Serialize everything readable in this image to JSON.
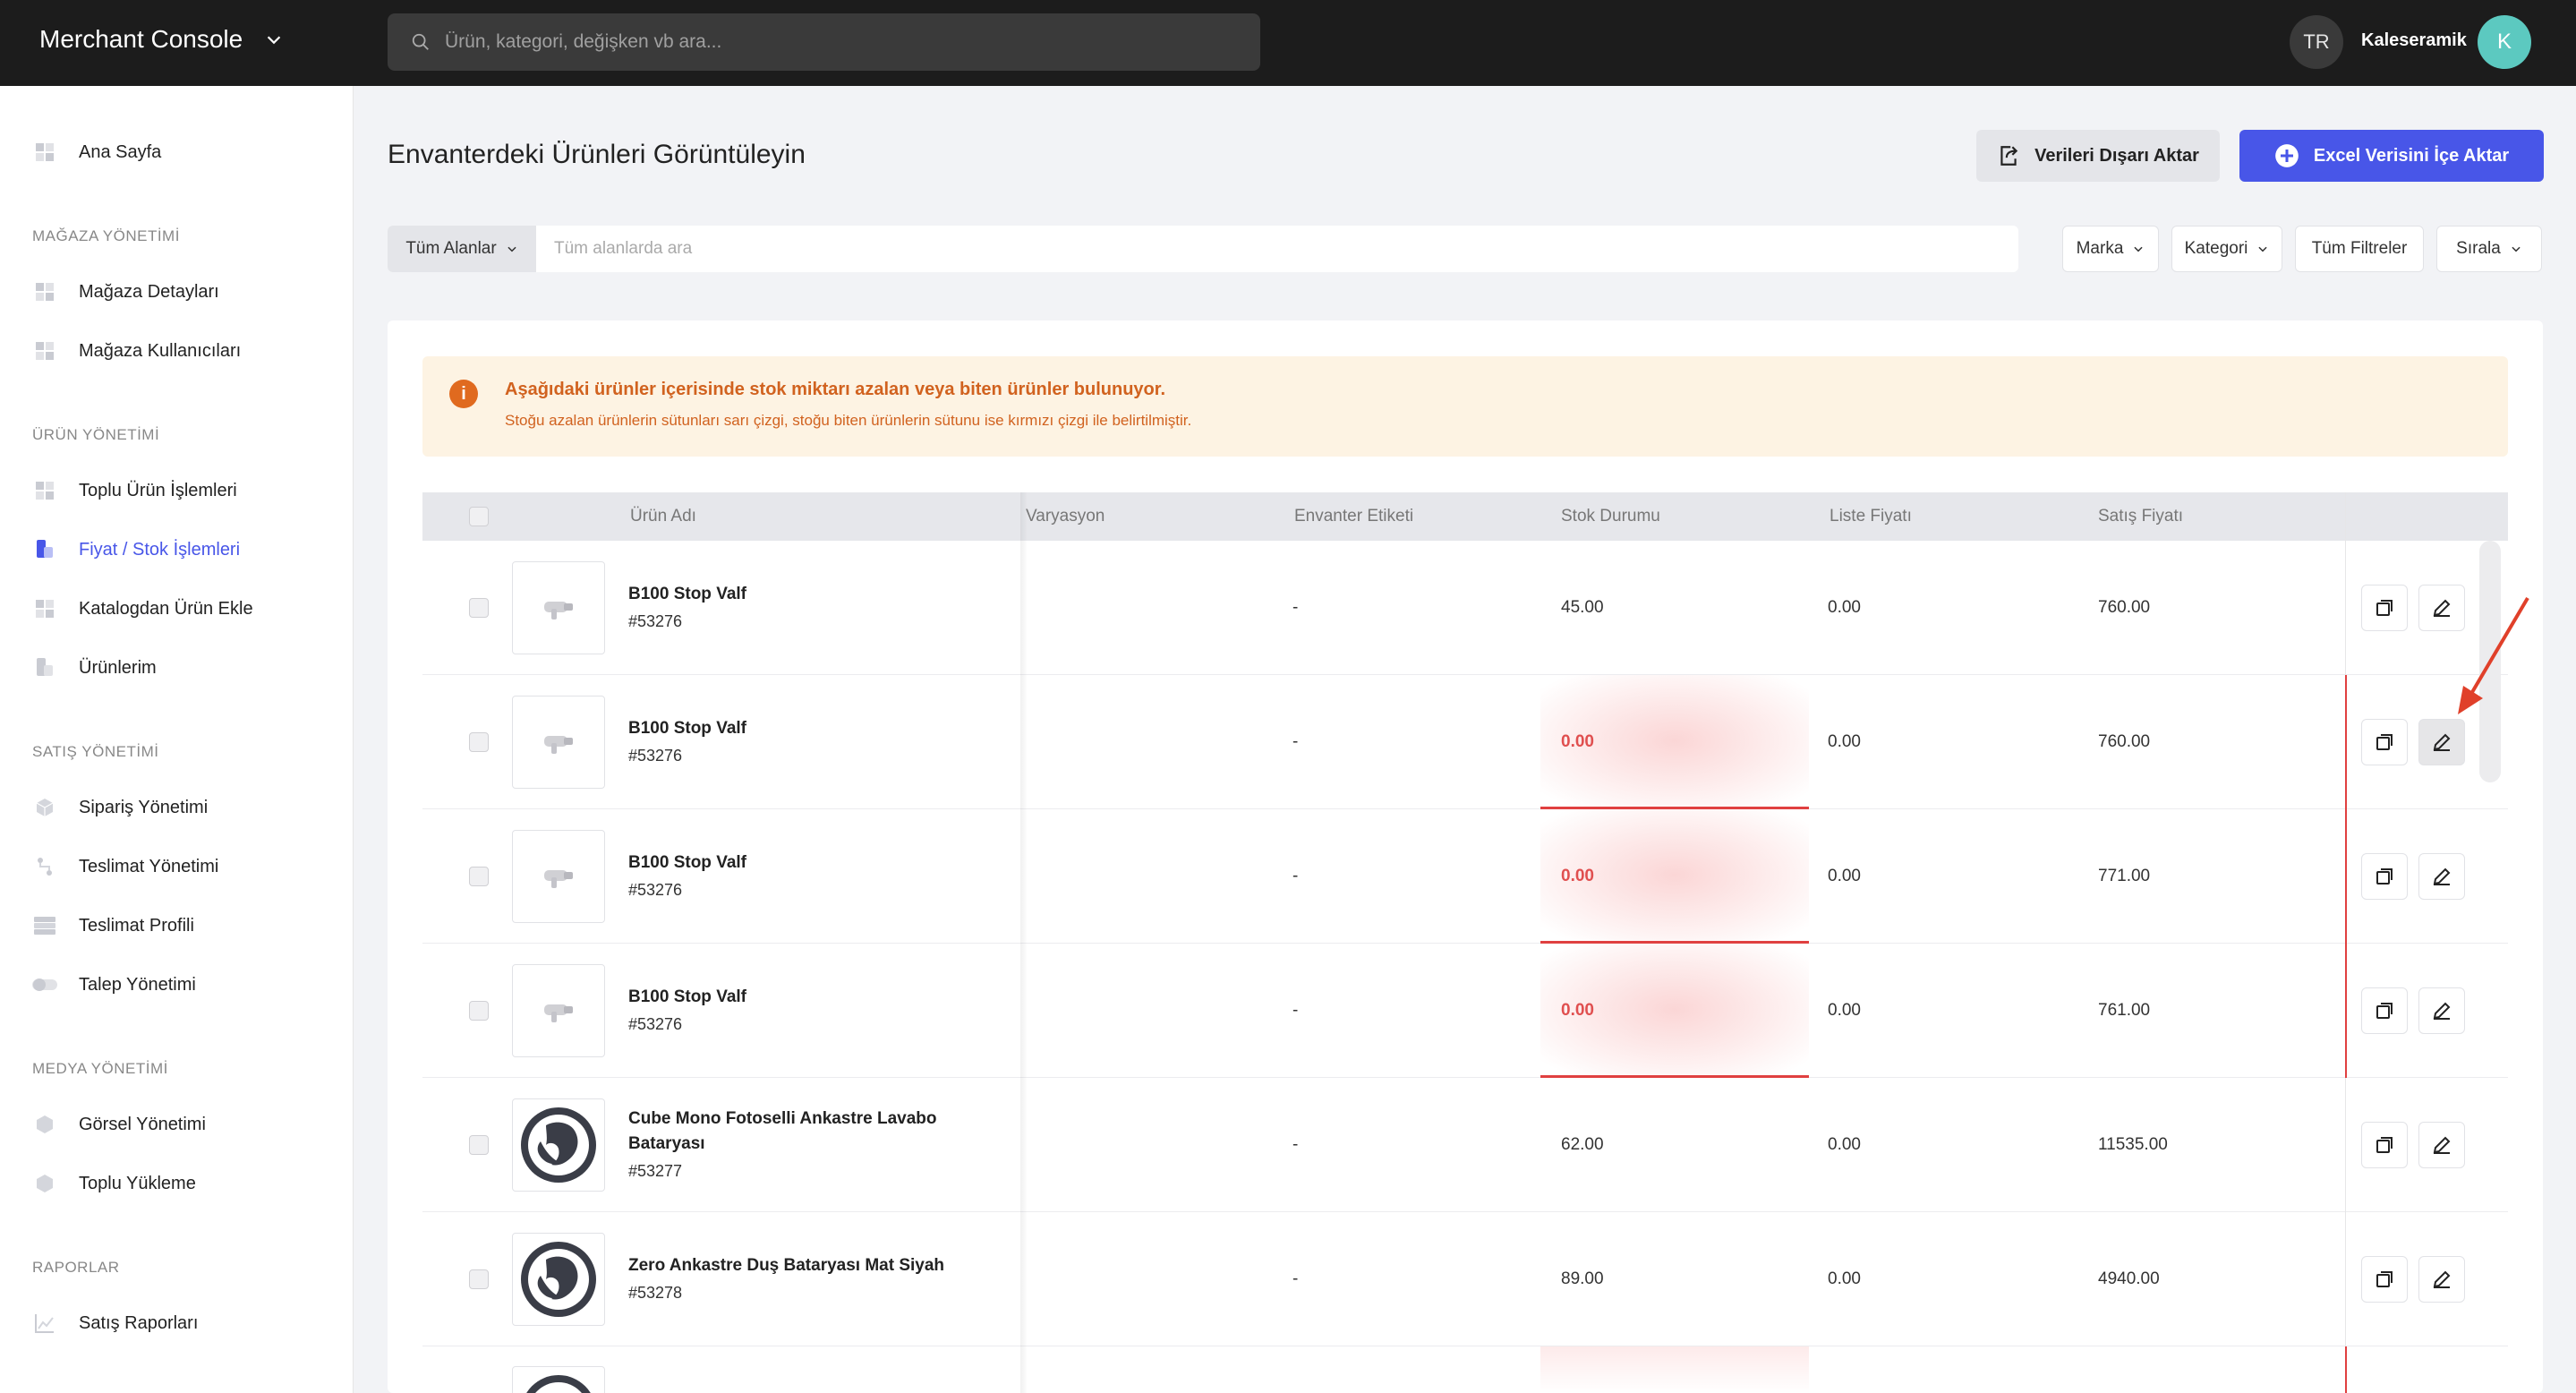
{
  "topbar": {
    "brand": "Merchant Console",
    "search_placeholder": "Ürün, kategori, değişken vb ara...",
    "lang": "TR",
    "username": "Kaleseramik",
    "avatar_initial": "K"
  },
  "sidebar": {
    "home": "Ana Sayfa",
    "sections": {
      "store": "MAĞAZA YÖNETİMİ",
      "product": "ÜRÜN YÖNETİMİ",
      "sales": "SATIŞ YÖNETİMİ",
      "media": "MEDYA YÖNETİMİ",
      "reports": "RAPORLAR"
    },
    "store_items": [
      "Mağaza Detayları",
      "Mağaza Kullanıcıları"
    ],
    "product_items": [
      "Toplu Ürün İşlemleri",
      "Fiyat / Stok İşlemleri",
      "Katalogdan Ürün Ekle",
      "Ürünlerim"
    ],
    "sales_items": [
      "Sipariş Yönetimi",
      "Teslimat Yönetimi",
      "Teslimat Profili",
      "Talep Yönetimi"
    ],
    "media_items": [
      "Görsel Yönetimi",
      "Toplu Yükleme"
    ],
    "report_items": [
      "Satış Raporları"
    ],
    "active_item": "Fiyat / Stok İşlemleri",
    "accent_color": "#4856e8"
  },
  "main": {
    "title": "Envanterdeki Ürünleri Görüntüleyin",
    "export_label": "Verileri Dışarı Aktar",
    "import_label": "Excel Verisini İçe Aktar",
    "field_select": "Tüm Alanlar",
    "search_placeholder": "Tüm alanlarda ara",
    "filters": {
      "brand": "Marka",
      "category": "Kategori",
      "all_filters": "Tüm Filtreler",
      "sort": "Sırala"
    },
    "alert": {
      "title": "Aşağıdaki ürünler içerisinde stok miktarı azalan veya biten ürünler bulunuyor.",
      "body": "Stoğu azalan ürünlerin sütunları sarı çizgi, stoğu biten ürünlerin sütunu ise kırmızı çizgi ile belirtilmiştir."
    },
    "columns": {
      "name": "Ürün Adı",
      "variation": "Varyasyon",
      "inventory_tag": "Envanter Etiketi",
      "stock": "Stok Durumu",
      "list_price": "Liste Fiyatı",
      "sale_price": "Satış Fiyatı"
    },
    "rows": [
      {
        "name": "B100 Stop Valf",
        "sku": "#53276",
        "tag": "-",
        "stock": "45.00",
        "list_price": "0.00",
        "sale_price": "760.00"
      },
      {
        "name": "B100 Stop Valf",
        "sku": "#53276",
        "tag": "-",
        "stock": "0.00",
        "list_price": "0.00",
        "sale_price": "760.00"
      },
      {
        "name": "B100 Stop Valf",
        "sku": "#53276",
        "tag": "-",
        "stock": "0.00",
        "list_price": "0.00",
        "sale_price": "771.00"
      },
      {
        "name": "B100 Stop Valf",
        "sku": "#53276",
        "tag": "-",
        "stock": "0.00",
        "list_price": "0.00",
        "sale_price": "761.00"
      },
      {
        "name": "Cube Mono Fotoselli Ankastre Lavabo Bataryası",
        "sku": "#53277",
        "tag": "-",
        "stock": "62.00",
        "list_price": "0.00",
        "sale_price": "11535.00"
      },
      {
        "name": "Zero Ankastre Duş Bataryası Mat Siyah",
        "sku": "#53278",
        "tag": "-",
        "stock": "89.00",
        "list_price": "0.00",
        "sale_price": "4940.00"
      }
    ],
    "out_of_stock_color": "#e04040"
  }
}
